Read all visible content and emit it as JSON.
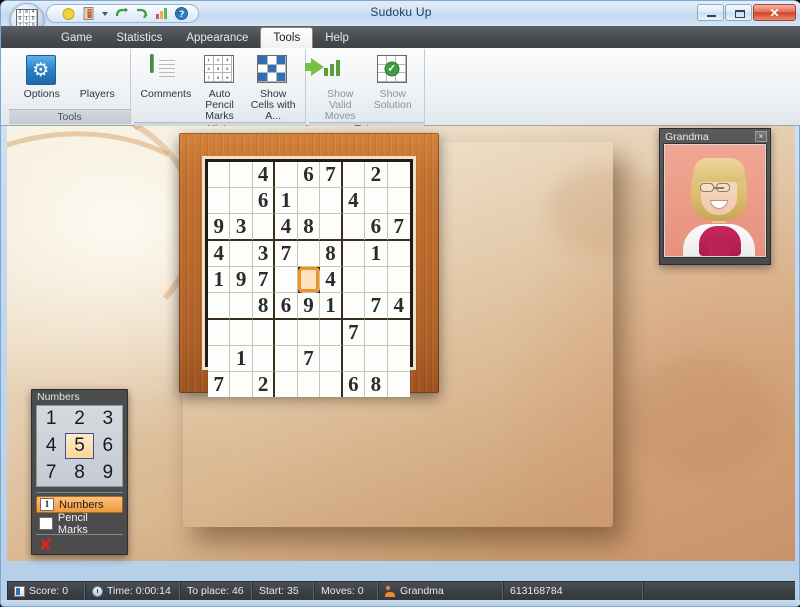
{
  "window": {
    "title": "Sudoku Up",
    "app_icon": "sudoku-grid-orb-icon",
    "minimize_label": "Minimize",
    "maximize_label": "Maximize",
    "close_label": "Close"
  },
  "quick_access": {
    "items": [
      {
        "icon": "new-game-icon",
        "label": "New Game"
      },
      {
        "icon": "exit-door-icon",
        "label": "Exit"
      },
      {
        "icon": "undo-icon",
        "label": "Undo"
      },
      {
        "icon": "redo-icon",
        "label": "Redo"
      },
      {
        "icon": "statistics-chart-icon",
        "label": "Statistics"
      },
      {
        "icon": "help-icon",
        "label": "Help"
      }
    ],
    "overflow_label": "≡"
  },
  "ribbon": {
    "tabs": [
      {
        "label": "Game",
        "active": false
      },
      {
        "label": "Statistics",
        "active": false
      },
      {
        "label": "Appearance",
        "active": false
      },
      {
        "label": "Tools",
        "active": true
      },
      {
        "label": "Help",
        "active": false
      }
    ],
    "groups": [
      {
        "label": "Tools",
        "items": [
          {
            "label": "Options",
            "icon": "gear-icon",
            "enabled": true
          },
          {
            "label": "Players",
            "icon": "people-icon",
            "enabled": true
          }
        ]
      },
      {
        "label": "Hints",
        "items": [
          {
            "label": "Comments",
            "icon": "notepad-icon",
            "enabled": true
          },
          {
            "label": "Auto Pencil Marks",
            "icon": "pencil-marks-grid-icon",
            "enabled": true
          },
          {
            "label": "Show Cells with A...",
            "icon": "highlighted-cells-grid-icon",
            "enabled": true
          }
        ]
      },
      {
        "label": "Tutor",
        "items": [
          {
            "label": "Show Valid Moves",
            "icon": "green-arrow-icon",
            "enabled": false
          },
          {
            "label": "Show Solution",
            "icon": "solution-check-grid-icon",
            "enabled": false
          }
        ]
      }
    ]
  },
  "board": {
    "selected_cell": {
      "row": 4,
      "col": 4
    },
    "rows": [
      [
        "",
        "",
        "4",
        "",
        "6",
        "7",
        "",
        "2",
        ""
      ],
      [
        "",
        "",
        "6",
        "1",
        "",
        "",
        "4",
        "",
        ""
      ],
      [
        "9",
        "3",
        "",
        "4",
        "8",
        "",
        "",
        "6",
        "7"
      ],
      [
        "4",
        "",
        "3",
        "7",
        "",
        "8",
        "",
        "1",
        ""
      ],
      [
        "1",
        "9",
        "7",
        "",
        "",
        "4",
        "",
        "",
        ""
      ],
      [
        "",
        "",
        "8",
        "6",
        "9",
        "1",
        "",
        "7",
        "4"
      ],
      [
        "",
        "",
        "",
        "",
        "",
        "",
        "7",
        "",
        ""
      ],
      [
        "",
        "1",
        "",
        "",
        "7",
        "",
        "",
        "",
        ""
      ],
      [
        "7",
        "",
        "2",
        "",
        "",
        "",
        "6",
        "8",
        ""
      ]
    ]
  },
  "numbers_panel": {
    "title": "Numbers",
    "keys": [
      "1",
      "2",
      "3",
      "4",
      "5",
      "6",
      "7",
      "8",
      "9"
    ],
    "selected_key": "5",
    "modes": [
      {
        "label": "Numbers",
        "icon": "number-one-icon",
        "active": true
      },
      {
        "label": "Pencil Marks",
        "icon": "pencil-marks-icon",
        "active": false
      }
    ],
    "clear_label": "✘",
    "clear_name": "clear-cell-x-icon"
  },
  "player_panel": {
    "name": "Grandma",
    "close_label": "×",
    "photo_alt": "grandma-portrait"
  },
  "status_bar": {
    "score": "Score: 0",
    "time": "Time: 0:00:14",
    "to_place": "To place: 46",
    "start": "Start: 35",
    "moves": "Moves: 0",
    "player": "Grandma",
    "game_id": "613168784"
  },
  "colors": {
    "accent_orange": "#f3921e",
    "selected_cell_fill": "#fde3c0",
    "frame_wood": "#b9692b",
    "titlebar_text": "#1c3d66",
    "ribbon_dark": "#4a4e53"
  }
}
